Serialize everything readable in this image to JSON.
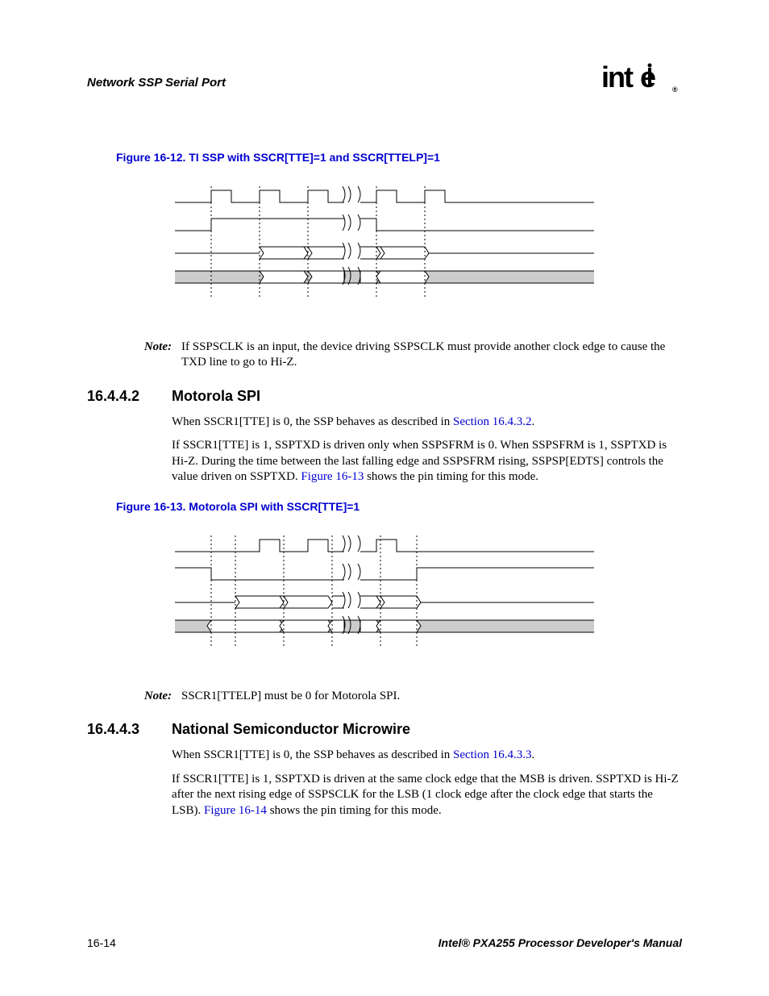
{
  "header": {
    "title": "Network SSP Serial Port",
    "logo": "intel",
    "reg": "®"
  },
  "fig12": {
    "title": "Figure 16-12. TI SSP with SSCR[TTE]=1 and SSCR[TTELP]=1"
  },
  "note1": {
    "label": "Note:",
    "text": "If SSPSCLK is an input, the device driving SSPSCLK must provide another clock edge to cause the TXD line to go to Hi-Z."
  },
  "sec2": {
    "num": "16.4.4.2",
    "title": "Motorola SPI",
    "p1a": "When SSCR1[TTE] is 0, the SSP behaves as described in ",
    "p1link": "Section 16.4.3.2",
    "p1b": ".",
    "p2a": "If SSCR1[TTE] is 1, SSPTXD is driven only when SSPSFRM is 0. When SSPSFRM is 1, SSPTXD is Hi-Z. During the time between the last falling edge and SSPSFRM rising, SSPSP[EDTS] controls the value driven on SSPTXD. ",
    "p2link": "Figure 16-13",
    "p2b": " shows the pin timing for this mode."
  },
  "fig13": {
    "title": "Figure 16-13. Motorola SPI with SSCR[TTE]=1"
  },
  "note2": {
    "label": "Note:",
    "text": "SSCR1[TTELP] must be 0 for Motorola SPI."
  },
  "sec3": {
    "num": "16.4.4.3",
    "title": "National Semiconductor Microwire",
    "p1a": "When SSCR1[TTE] is 0, the SSP behaves as described in ",
    "p1link": "Section 16.4.3.3",
    "p1b": ".",
    "p2a": "If SSCR1[TTE] is 1, SSPTXD is driven at the same clock edge that the MSB is driven. SSPTXD is Hi-Z after the next rising edge of SSPSCLK for the LSB (1 clock edge after the clock edge that starts the LSB). ",
    "p2link": "Figure 16-14",
    "p2b": " shows the pin timing for this mode."
  },
  "footer": {
    "page": "16-14",
    "manual": "Intel® PXA255 Processor Developer's Manual"
  }
}
